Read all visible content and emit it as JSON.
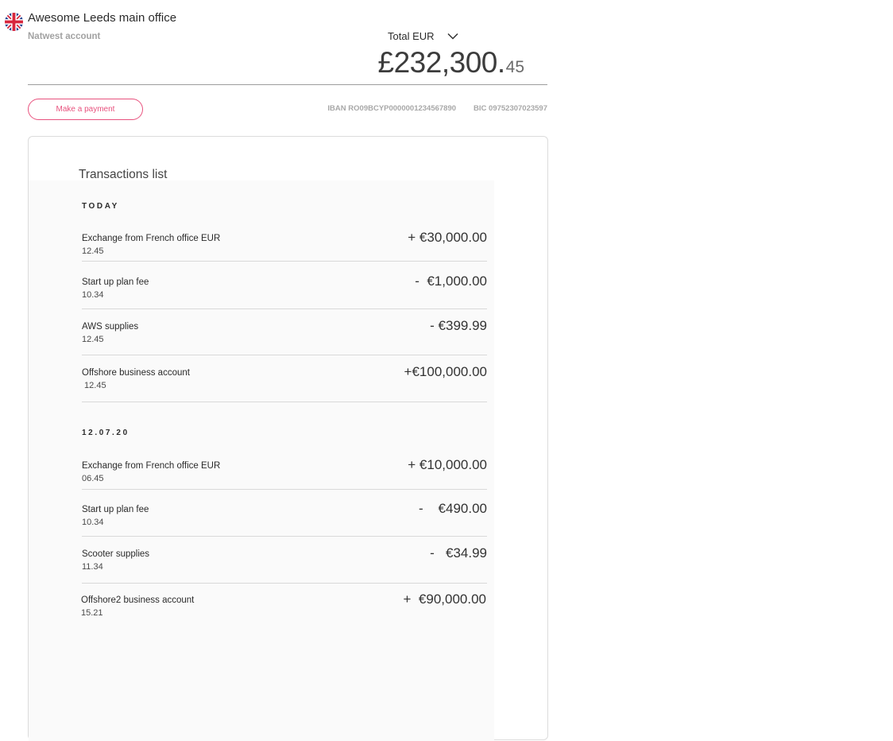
{
  "account": {
    "flag_icon": "uk-flag-icon",
    "title": "Awesome Leeds main office",
    "subtitle": "Natwest account"
  },
  "balance": {
    "currency_label": "Total EUR",
    "dropdown_icon": "chevron-down-icon",
    "main": "£232,300.",
    "cents": "45"
  },
  "actions": {
    "make_payment_label": "Make a payment"
  },
  "bank": {
    "iban": "IBAN RO09BCYP0000001234567890",
    "bic": "BIC 09752307023597"
  },
  "colors": {
    "accent": "#e8527e",
    "muted_text": "#a8a8a8",
    "divider": "#d9d9d9"
  },
  "transactions": {
    "title": "Transactions list",
    "groups": [
      {
        "label": "TODAY",
        "items": [
          {
            "name": "Exchange from French office EUR",
            "time": "12.45",
            "amount": "+ €30,000.00"
          },
          {
            "name": "Start up plan fee",
            "time": "10.34",
            "amount": "-  €1,000.00"
          },
          {
            "name": "AWS supplies",
            "time": "12.45",
            "amount": "- €399.99"
          },
          {
            "name": "Offshore business account",
            "time": " 12.45",
            "amount": "+€100,000.00"
          }
        ]
      },
      {
        "label": "12.07.20",
        "items": [
          {
            "name": "Exchange from French office EUR",
            "time": "06.45",
            "amount": "+ €10,000.00"
          },
          {
            "name": "Start up plan fee",
            "time": "10.34",
            "amount": "-    €490.00"
          },
          {
            "name": "Scooter supplies",
            "time": "11.34",
            "amount": "-   €34.99"
          },
          {
            "name": "Offshore2 business account",
            "time": "15.21",
            "amount": "+  €90,000.00"
          }
        ]
      }
    ]
  }
}
